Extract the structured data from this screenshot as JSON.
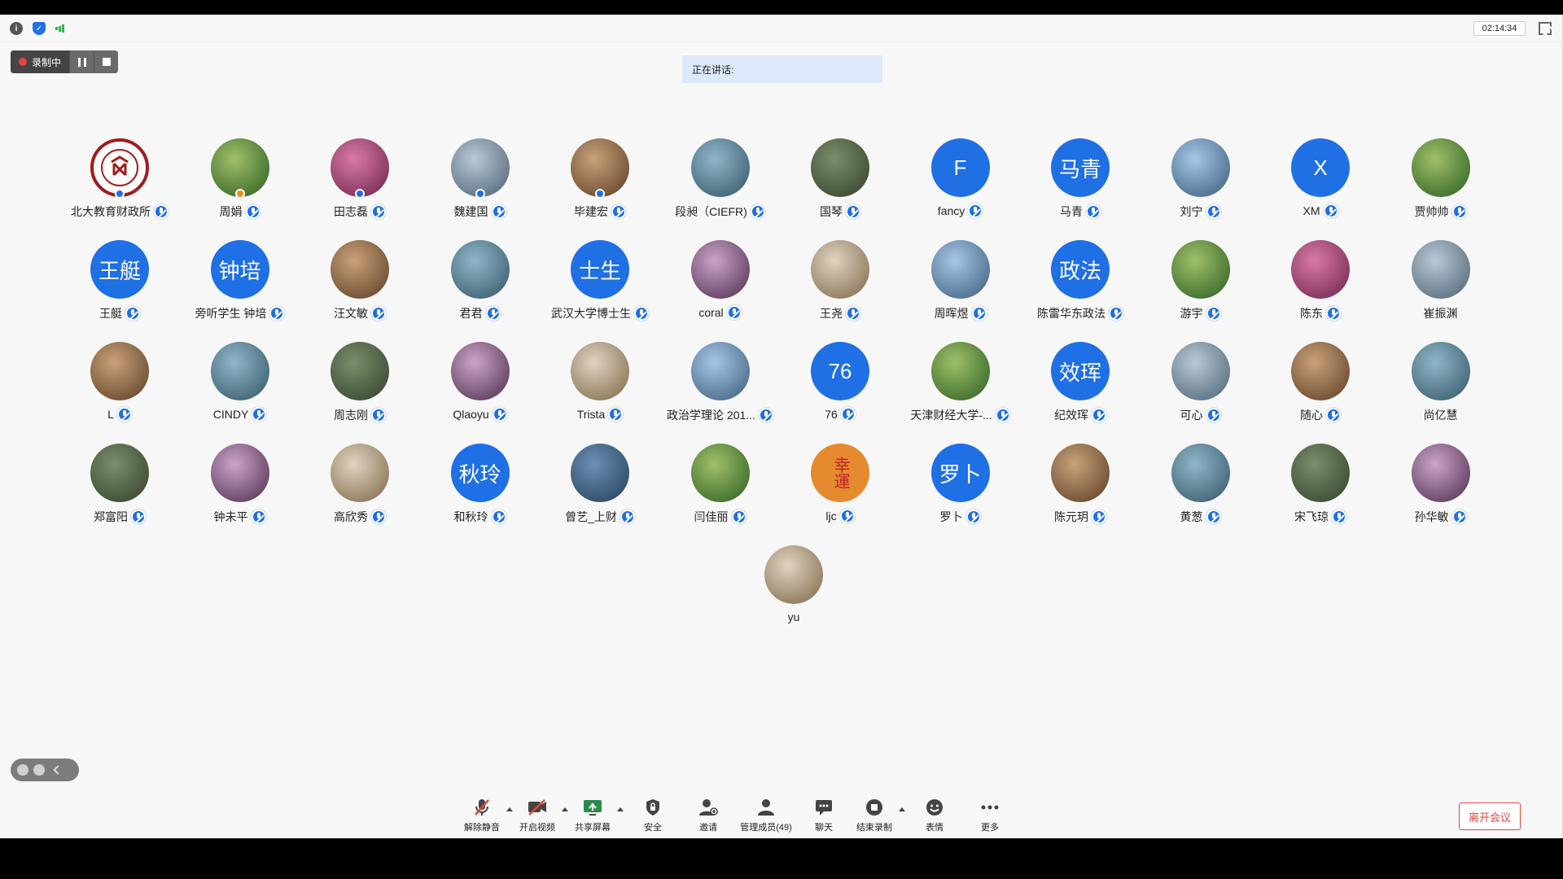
{
  "window": {
    "timer": "02:14:34",
    "recording_label": "录制中",
    "speaking_label": "正在讲话:",
    "leave_label": "离开会议"
  },
  "colors": {
    "accent": "#1f6fe5",
    "record_red": "#e2463c",
    "speaking_bg": "#dce9fb"
  },
  "participants": [
    {
      "name": "北大教育财政所",
      "avatar": "logo-red",
      "avatar_text": ""
    },
    {
      "name": "周娟",
      "avatar": "photo",
      "avatar_text": ""
    },
    {
      "name": "田志磊",
      "avatar": "photo",
      "avatar_text": ""
    },
    {
      "name": "魏建国",
      "avatar": "photo",
      "avatar_text": ""
    },
    {
      "name": "毕建宏",
      "avatar": "photo",
      "avatar_text": ""
    },
    {
      "name": "段昶（CIEFR)",
      "avatar": "photo",
      "avatar_text": ""
    },
    {
      "name": "国琴",
      "avatar": "photo",
      "avatar_text": ""
    },
    {
      "name": "fancy",
      "avatar": "text",
      "avatar_text": "F"
    },
    {
      "name": "马青",
      "avatar": "text",
      "avatar_text": "马青"
    },
    {
      "name": "刘宁",
      "avatar": "photo",
      "avatar_text": ""
    },
    {
      "name": "XM",
      "avatar": "text",
      "avatar_text": "X"
    },
    {
      "name": "贾帅帅",
      "avatar": "photo",
      "avatar_text": ""
    },
    {
      "name": "王艇",
      "avatar": "text",
      "avatar_text": "王艇"
    },
    {
      "name": "旁听学生 钟培",
      "avatar": "text",
      "avatar_text": "钟培"
    },
    {
      "name": "汪文敏",
      "avatar": "photo",
      "avatar_text": ""
    },
    {
      "name": "君君",
      "avatar": "photo",
      "avatar_text": ""
    },
    {
      "name": "武汉大学博士生",
      "avatar": "text",
      "avatar_text": "士生"
    },
    {
      "name": "coral",
      "avatar": "photo",
      "avatar_text": ""
    },
    {
      "name": "王尧",
      "avatar": "photo",
      "avatar_text": ""
    },
    {
      "name": "周晖煜",
      "avatar": "photo",
      "avatar_text": ""
    },
    {
      "name": "陈雷华东政法",
      "avatar": "text",
      "avatar_text": "政法"
    },
    {
      "name": "游宇",
      "avatar": "photo",
      "avatar_text": ""
    },
    {
      "name": "陈东",
      "avatar": "photo",
      "avatar_text": ""
    },
    {
      "name": "崔振渊",
      "avatar": "photo",
      "avatar_text": ""
    },
    {
      "name": "L",
      "avatar": "photo",
      "avatar_text": ""
    },
    {
      "name": "CINDY",
      "avatar": "photo",
      "avatar_text": ""
    },
    {
      "name": "周志刚",
      "avatar": "photo",
      "avatar_text": ""
    },
    {
      "name": "Qlaoyu",
      "avatar": "photo",
      "avatar_text": ""
    },
    {
      "name": "Trista",
      "avatar": "photo",
      "avatar_text": ""
    },
    {
      "name": "政治学理论 201...",
      "avatar": "photo",
      "avatar_text": ""
    },
    {
      "name": "76",
      "avatar": "text",
      "avatar_text": "76"
    },
    {
      "name": "天津财经大学-...",
      "avatar": "photo",
      "avatar_text": ""
    },
    {
      "name": "纪效珲",
      "avatar": "text",
      "avatar_text": "效珲"
    },
    {
      "name": "可心",
      "avatar": "photo",
      "avatar_text": ""
    },
    {
      "name": "随心",
      "avatar": "photo",
      "avatar_text": ""
    },
    {
      "name": "尚亿慧",
      "avatar": "photo",
      "avatar_text": ""
    },
    {
      "name": "郑富阳",
      "avatar": "photo",
      "avatar_text": ""
    },
    {
      "name": "钟未平",
      "avatar": "photo",
      "avatar_text": ""
    },
    {
      "name": "高欣秀",
      "avatar": "photo",
      "avatar_text": ""
    },
    {
      "name": "和秋玲",
      "avatar": "text",
      "avatar_text": "秋玲"
    },
    {
      "name": "曾艺_上财",
      "avatar": "photo",
      "avatar_text": ""
    },
    {
      "name": "闫佳丽",
      "avatar": "photo",
      "avatar_text": ""
    },
    {
      "name": "ljc",
      "avatar": "orange",
      "avatar_text": "幸運"
    },
    {
      "name": "罗卜",
      "avatar": "text",
      "avatar_text": "罗卜"
    },
    {
      "name": "陈元玥",
      "avatar": "photo",
      "avatar_text": ""
    },
    {
      "name": "黄葱",
      "avatar": "photo",
      "avatar_text": ""
    },
    {
      "name": "宋飞琼",
      "avatar": "photo",
      "avatar_text": ""
    },
    {
      "name": "孙华敏",
      "avatar": "photo",
      "avatar_text": ""
    },
    {
      "name": "yu",
      "avatar": "photo",
      "avatar_text": ""
    }
  ],
  "toolbar": {
    "unmute": "解除静音",
    "video": "开启视频",
    "share": "共享屏幕",
    "security": "安全",
    "invite": "邀请",
    "participants": "管理成员(49)",
    "chat": "聊天",
    "stop_record": "结束录制",
    "reactions": "表情",
    "more": "更多"
  }
}
